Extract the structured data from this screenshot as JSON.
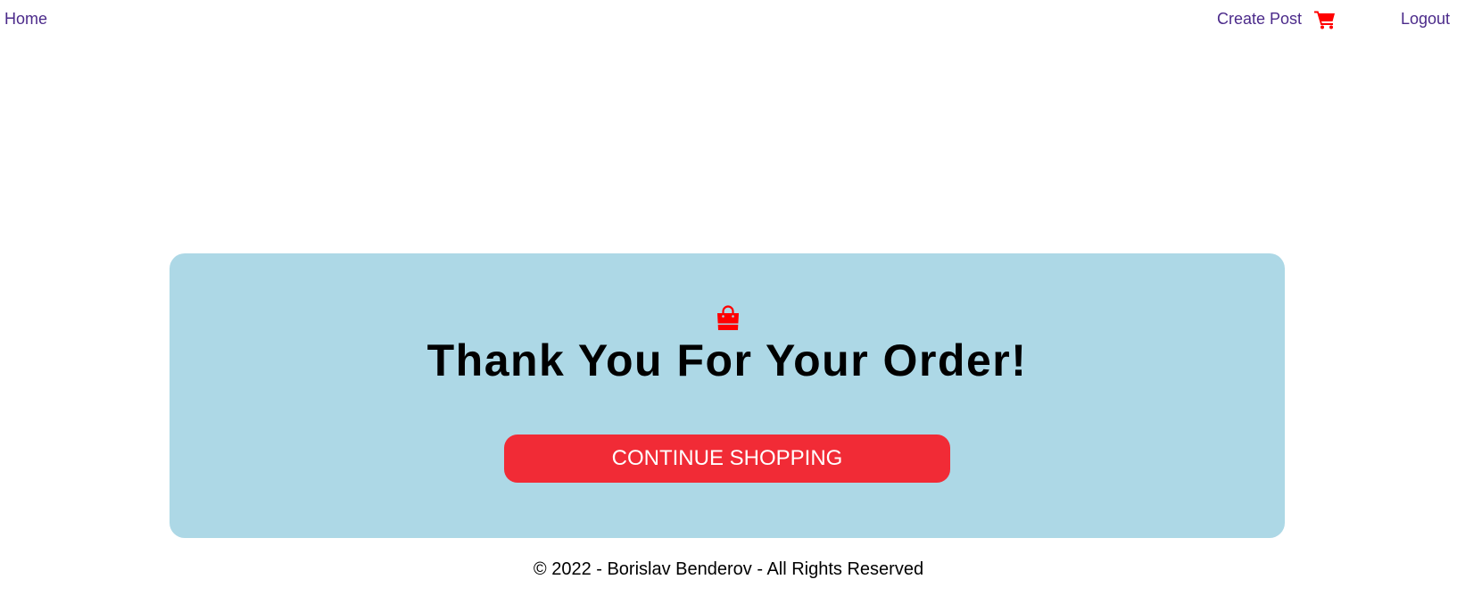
{
  "nav": {
    "home_label": "Home",
    "create_post_label": "Create Post",
    "logout_label": "Logout",
    "cart_icon": "shopping-cart-icon"
  },
  "confirmation": {
    "icon": "shopping-bag-icon",
    "title": "Thank You For Your Order!",
    "button_label": "CONTINUE SHOPPING"
  },
  "footer": {
    "text": "© 2022 - Borislav Benderov - All Rights Reserved"
  },
  "colors": {
    "nav_link": "#4b2a8a",
    "accent_red": "#f12b36",
    "card_background": "#add8e6"
  }
}
